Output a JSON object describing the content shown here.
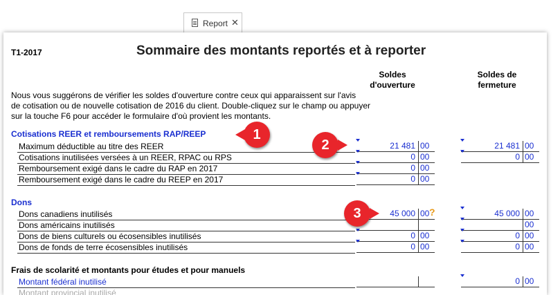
{
  "tab": {
    "label": "Report",
    "close": "✕",
    "icon": "document-icon"
  },
  "header": {
    "form_id": "T1-2017",
    "title": "Sommaire des montants reportés et à reporter"
  },
  "columns": {
    "opening_line1": "Soldes",
    "opening_line2": "d'ouverture",
    "closing_line1": "Soldes de",
    "closing_line2": "fermeture"
  },
  "intro": [
    "Nous vous suggérons de vérifier les soldes d'ouverture contre ceux qui apparaissent sur l'avis",
    "de cotisation ou de nouvelle cotisation de 2016 du client. Double-cliquez sur le champ ou appuyer",
    "sur la touche F6 pour accéder le formulaire d'où provient les montants."
  ],
  "sections": {
    "reer": {
      "title": "Cotisations REER et remboursements RAP/REEP",
      "rows": [
        {
          "label": "Maximum déductible au titre des REER",
          "open_amt": "21 481",
          "open_cts": "00",
          "close_amt": "21 481",
          "close_cts": "00"
        },
        {
          "label": "Cotisations inutilisées versées à un REER, RPAC ou RPS",
          "open_amt": "0",
          "open_cts": "00",
          "close_amt": "0",
          "close_cts": "00"
        },
        {
          "label": "Remboursement exigé dans le cadre du RAP en 2017",
          "open_amt": "0",
          "open_cts": "00"
        },
        {
          "label": "Remboursement exigé dans le cadre du REEP en 2017",
          "open_amt": "0",
          "open_cts": "00"
        }
      ]
    },
    "dons": {
      "title": "Dons",
      "rows": [
        {
          "label": "Dons canadiens inutilisés",
          "open_amt": "45 000",
          "open_cts": "00",
          "open_flag": "?",
          "close_amt": "45 000",
          "close_cts": "00"
        },
        {
          "label": "Dons américains inutilisés",
          "open_amt": "",
          "open_cts": "",
          "close_amt": "",
          "close_cts": "00"
        },
        {
          "label": "Dons de biens culturels ou écosensibles inutilisés",
          "open_amt": "0",
          "open_cts": "00",
          "close_amt": "0",
          "close_cts": "00"
        },
        {
          "label": "Dons de fonds de terre écosensibles inutilisés",
          "open_amt": "0",
          "open_cts": "00",
          "close_amt": "0",
          "close_cts": "00"
        }
      ]
    },
    "frais": {
      "title": "Frais de scolarité et montants pour études et pour manuels",
      "rows": [
        {
          "label": "Montant fédéral inutilisé",
          "open_amt": "",
          "open_cts": "",
          "close_amt": "0",
          "close_cts": "00"
        },
        {
          "label": "Montant provincial inutilisé"
        }
      ]
    }
  },
  "callouts": [
    "1",
    "2",
    "3"
  ],
  "colors": {
    "link_blue": "#1a2fd0",
    "callout_red": "#e8252b",
    "warning_orange": "#e89a1a"
  }
}
